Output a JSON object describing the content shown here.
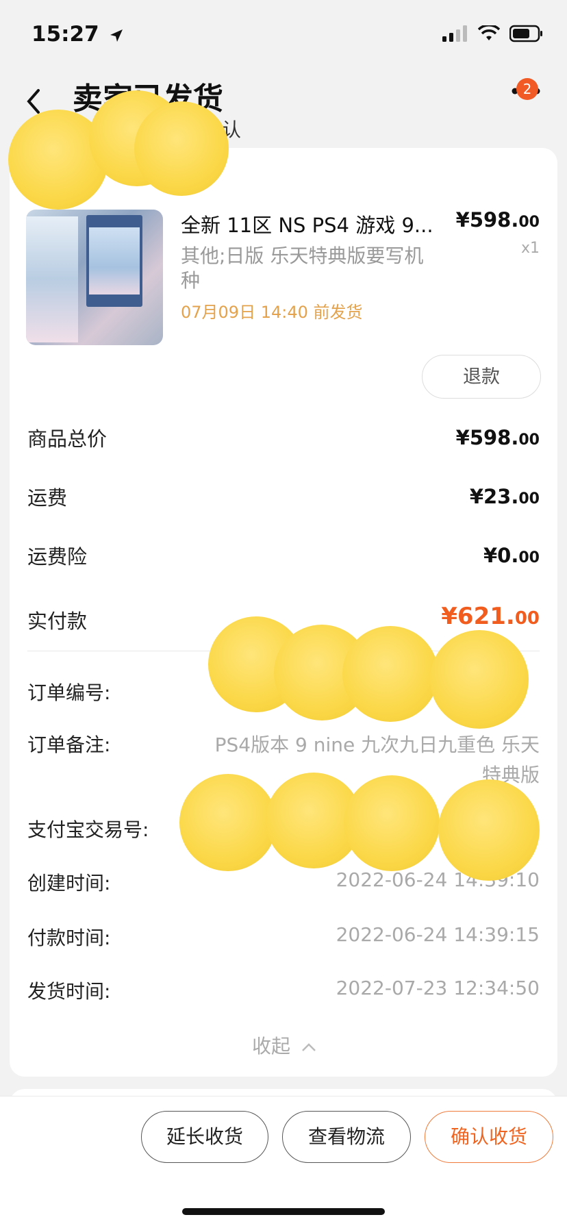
{
  "status_bar": {
    "time": "15:27"
  },
  "header": {
    "title": "卖家已发货",
    "subtitle": "确认",
    "badge_count": "2"
  },
  "item": {
    "title": "全新 11区 NS PS4 游戏 9...",
    "sku": "其他;日版 乐天特典版要写机种",
    "deadline": "07月09日 14:40 前发货",
    "price_int": "¥598.",
    "price_dec": "00",
    "qty": "x1",
    "refund_label": "退款"
  },
  "summary": {
    "total_label": "商品总价",
    "total_int": "¥598.",
    "total_dec": "00",
    "shipping_label": "运费",
    "shipping_int": "¥23.",
    "shipping_dec": "00",
    "insurance_label": "运费险",
    "insurance_int": "¥0.",
    "insurance_dec": "00",
    "paid_label": "实付款",
    "paid_int": "¥621.",
    "paid_dec": "00"
  },
  "order_info": {
    "order_no_label": "订单编号:",
    "note_label": "订单备注:",
    "note_value_1": "PS4版本 9 nine 九次九日九重色 乐天",
    "note_value_2": "特典版",
    "alipay_label": "支付宝交易号:",
    "created_label": "创建时间:",
    "created_value": "2022-06-24 14:39:10",
    "paid_time_label": "付款时间:",
    "paid_time_value": "2022-06-24 14:39:15",
    "shipped_label": "发货时间:",
    "shipped_value": "2022-07-23 12:34:50",
    "collapse_label": "收起"
  },
  "actions": {
    "extend": "延长收货",
    "logistics": "查看物流",
    "confirm": "确认收货"
  },
  "colors": {
    "accent": "#f06421",
    "deadline": "#e3a24b",
    "badge": "#f15a24"
  },
  "icons": [
    "location-arrow-icon",
    "signal-icon",
    "wifi-icon",
    "battery-icon",
    "back-icon",
    "more-icon",
    "chevron-up-icon"
  ]
}
